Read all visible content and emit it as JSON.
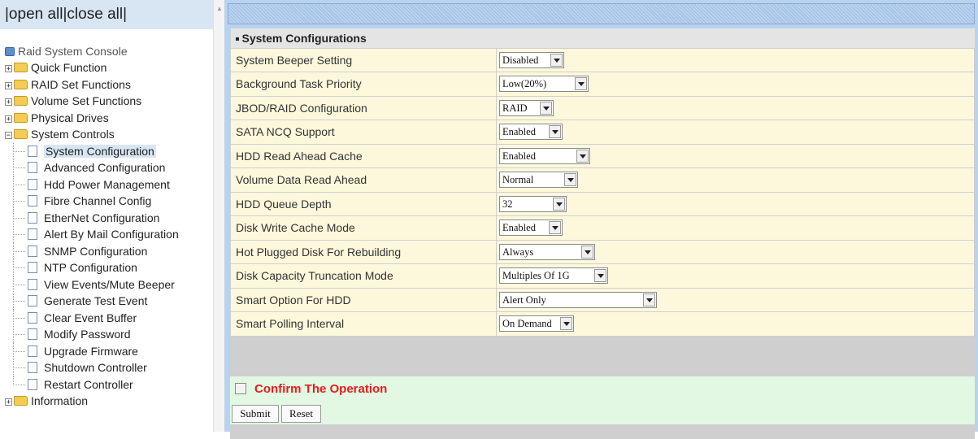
{
  "nav": {
    "open_all": "|open all",
    "close_all": "|close all|",
    "root_label": "Raid System Console",
    "folders": [
      {
        "label": "Quick Function",
        "expanded": false
      },
      {
        "label": "RAID Set Functions",
        "expanded": false
      },
      {
        "label": "Volume Set Functions",
        "expanded": false
      },
      {
        "label": "Physical Drives",
        "expanded": false
      },
      {
        "label": "System Controls",
        "expanded": true
      }
    ],
    "system_controls_items": [
      "System Configuration",
      "Advanced Configuration",
      "Hdd Power Management",
      "Fibre Channel Config",
      "EtherNet Configuration",
      "Alert By Mail Configuration",
      "SNMP Configuration",
      "NTP Configuration",
      "View Events/Mute Beeper",
      "Generate Test Event",
      "Clear Event Buffer",
      "Modify Password",
      "Upgrade Firmware",
      "Shutdown Controller",
      "Restart Controller"
    ],
    "selected_item": "System Configuration",
    "last_folder": "Information"
  },
  "panel": {
    "title": "System Configurations",
    "settings": [
      {
        "label": "System Beeper Setting",
        "value": "Disabled"
      },
      {
        "label": "Background Task Priority",
        "value": "Low(20%)"
      },
      {
        "label": "JBOD/RAID Configuration",
        "value": "RAID"
      },
      {
        "label": "SATA NCQ Support",
        "value": "Enabled"
      },
      {
        "label": "HDD Read Ahead Cache",
        "value": "Enabled"
      },
      {
        "label": "Volume Data Read Ahead",
        "value": "Normal"
      },
      {
        "label": "HDD Queue Depth",
        "value": "32"
      },
      {
        "label": "Disk Write Cache Mode",
        "value": "Enabled"
      },
      {
        "label": "Hot Plugged Disk For Rebuilding",
        "value": "Always"
      },
      {
        "label": "Disk Capacity Truncation Mode",
        "value": "Multiples Of 1G"
      },
      {
        "label": "Smart Option For HDD",
        "value": "Alert Only"
      },
      {
        "label": "Smart Polling Interval",
        "value": "On Demand"
      }
    ],
    "confirm_label": "Confirm The Operation",
    "confirm_checked": false,
    "submit_label": "Submit",
    "reset_label": "Reset"
  },
  "colors": {
    "accent_blue": "#b8d3ee",
    "row_bg": "#fdf8dc",
    "confirm_bg": "#e2f8e2",
    "confirm_text": "#e02020"
  }
}
